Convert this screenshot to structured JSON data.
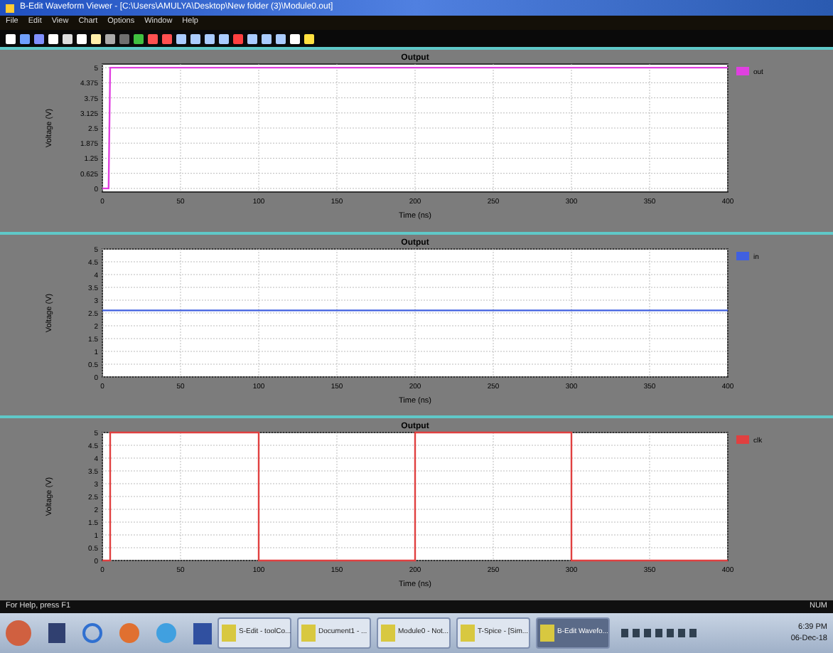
{
  "window": {
    "title": "B-Edit Waveform Viewer - [C:\\Users\\AMULYA\\Desktop\\New folder (3)\\Module0.out]"
  },
  "menu": [
    "File",
    "Edit",
    "View",
    "Chart",
    "Options",
    "Window",
    "Help"
  ],
  "charts": [
    {
      "chart_data": {
        "type": "line",
        "title": "Output",
        "xlabel": "Time (ns)",
        "ylabel": "Voltage (V)",
        "grid": true,
        "x": [
          0,
          4,
          5,
          400
        ],
        "xlim": [
          0,
          400
        ],
        "ylim": [
          -0.15,
          5.15
        ],
        "xticks": [
          0,
          50,
          100,
          150,
          200,
          250,
          300,
          350,
          400
        ],
        "yticks": [
          0,
          0.625,
          1.25,
          1.875,
          2.5,
          3.125,
          3.75,
          4.375,
          5
        ],
        "series": [
          {
            "name": "out",
            "color": "#e040e0",
            "values": [
              0,
              0,
              5,
              5
            ]
          }
        ]
      }
    },
    {
      "chart_data": {
        "type": "line",
        "title": "Output",
        "xlabel": "Time (ns)",
        "ylabel": "Voltage (V)",
        "grid": true,
        "x": [
          0,
          400
        ],
        "xlim": [
          0,
          400
        ],
        "ylim": [
          0,
          5
        ],
        "xticks": [
          0,
          50,
          100,
          150,
          200,
          250,
          300,
          350,
          400
        ],
        "yticks": [
          0,
          0.5,
          1,
          1.5,
          2,
          2.5,
          3,
          3.5,
          4,
          4.5,
          5
        ],
        "series": [
          {
            "name": "in",
            "color": "#4060e0",
            "values": [
              2.6,
              2.6
            ]
          }
        ]
      }
    },
    {
      "chart_data": {
        "type": "line",
        "title": "Output",
        "xlabel": "Time (ns)",
        "ylabel": "Voltage (V)",
        "grid": true,
        "x": [
          0,
          5,
          5,
          100,
          100,
          200,
          200,
          300,
          300,
          400
        ],
        "xlim": [
          0,
          400
        ],
        "ylim": [
          0,
          5
        ],
        "xticks": [
          0,
          50,
          100,
          150,
          200,
          250,
          300,
          350,
          400
        ],
        "yticks": [
          0,
          0.5,
          1,
          1.5,
          2,
          2.5,
          3,
          3.5,
          4,
          4.5,
          5
        ],
        "series": [
          {
            "name": "clk",
            "color": "#e04040",
            "values": [
              0,
              0,
              5,
              5,
              0,
              0,
              5,
              5,
              0,
              0
            ]
          }
        ]
      }
    }
  ],
  "status_bar": {
    "help": "For Help, press F1",
    "num": "NUM"
  },
  "taskbar": {
    "tasks": [
      {
        "label": "S-Edit - toolCo...",
        "selected": false
      },
      {
        "label": "Document1 - ...",
        "selected": false
      },
      {
        "label": "Module0 - Not...",
        "selected": false
      },
      {
        "label": "T-Spice - [Sim...",
        "selected": false
      },
      {
        "label": "B-Edit Wavefo...",
        "selected": true
      }
    ],
    "time": "6:39 PM",
    "date": "06-Dec-18"
  }
}
